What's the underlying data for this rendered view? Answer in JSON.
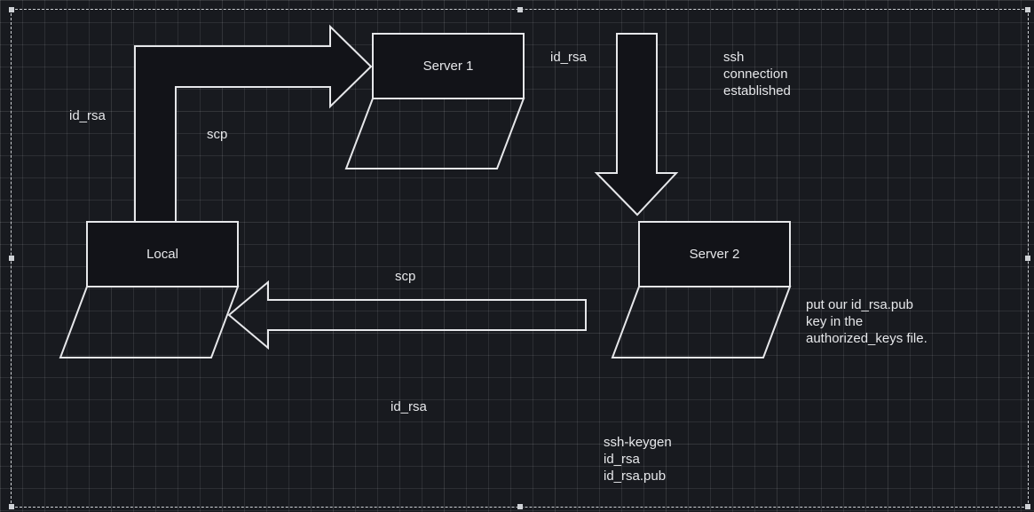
{
  "nodes": {
    "local": {
      "label": "Local"
    },
    "server1": {
      "label": "Server 1"
    },
    "server2": {
      "label": "Server 2"
    }
  },
  "labels": {
    "id_rsa_left": "id_rsa",
    "scp_elbow": "scp",
    "id_rsa_top": "id_rsa",
    "ssh_established": "ssh\nconnection\nestablished",
    "scp_bottom": "scp",
    "put_pub": "put our id_rsa.pub\nkey in the\nauthorized_keys file.",
    "id_rsa_bottom": "id_rsa",
    "keygen": "ssh-keygen\nid_rsa\nid_rsa.pub"
  }
}
